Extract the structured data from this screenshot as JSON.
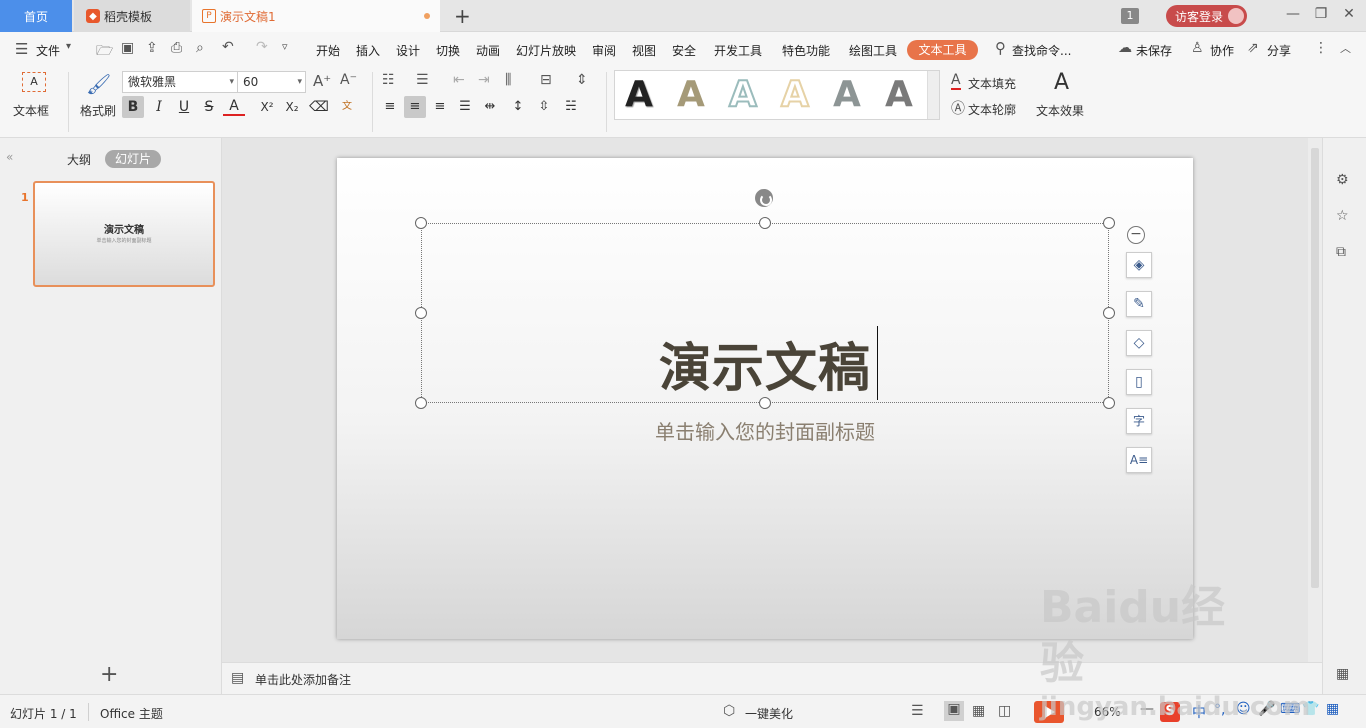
{
  "tabs": {
    "home": "首页",
    "docer": "稻壳模板",
    "doc": "演示文稿1",
    "new": "+"
  },
  "titlebar": {
    "window_count": "1",
    "login": "访客登录"
  },
  "menu": {
    "file": "文件",
    "items": [
      "开始",
      "插入",
      "设计",
      "切换",
      "动画",
      "幻灯片放映",
      "审阅",
      "视图",
      "安全",
      "开发工具",
      "特色功能",
      "绘图工具"
    ],
    "active_tab": "文本工具",
    "search": "查找命令...",
    "unsaved": "未保存",
    "collab": "协作",
    "share": "分享"
  },
  "ribbon": {
    "textbox": "文本框",
    "format_painter": "格式刷",
    "font_name": "微软雅黑",
    "font_size": "60",
    "text_fill": "文本填充",
    "text_outline": "文本轮廓",
    "text_effect": "文本效果",
    "style_colors": [
      "#222222",
      "#a59a78",
      "#9bbcbc",
      "#e6d2a6",
      "#8d9595",
      "#7a7a7a"
    ]
  },
  "leftpanel": {
    "outline_tab": "大纲",
    "slides_tab": "幻灯片",
    "slide_number": "1",
    "thumb_title": "演示文稿",
    "thumb_subtitle": "单击输入您的封面副标题"
  },
  "slide": {
    "title": "演示文稿",
    "subtitle": "单击输入您的封面副标题"
  },
  "notes": {
    "placeholder": "单击此处添加备注"
  },
  "status": {
    "slide_info": "幻灯片 1 / 1",
    "theme": "Office 主题",
    "beautify": "一键美化",
    "zoom": "66%"
  },
  "watermark": {
    "brand": "Baidu经验",
    "url": "jingyan.baidu.com"
  }
}
